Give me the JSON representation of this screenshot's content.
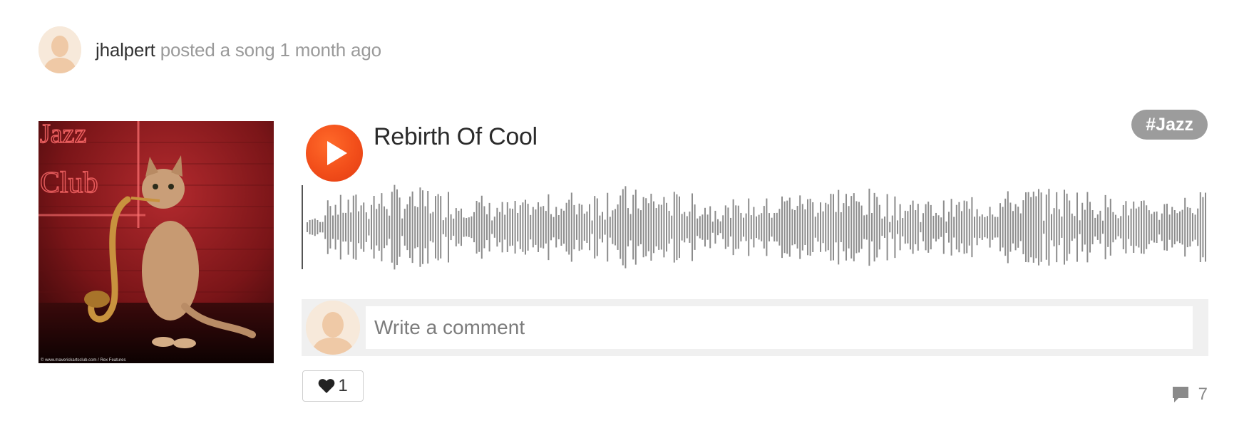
{
  "post": {
    "username": "jhalpert",
    "action_text": " posted a song 1 month ago"
  },
  "cover": {
    "sign_line1": "Jazz",
    "sign_line2": "Club",
    "credit": "© www.maverickartsclub.com / Rex Features"
  },
  "track": {
    "title": "Rebirth Of Cool",
    "tag": "#Jazz",
    "progress": 0
  },
  "comment_box": {
    "placeholder": "Write a comment"
  },
  "like": {
    "count": "1"
  },
  "comments": {
    "count": "7"
  },
  "colors": {
    "play_button": "#f24e1a",
    "waveform": "#8c8c8c",
    "tag_background": "#9c9c9c"
  }
}
